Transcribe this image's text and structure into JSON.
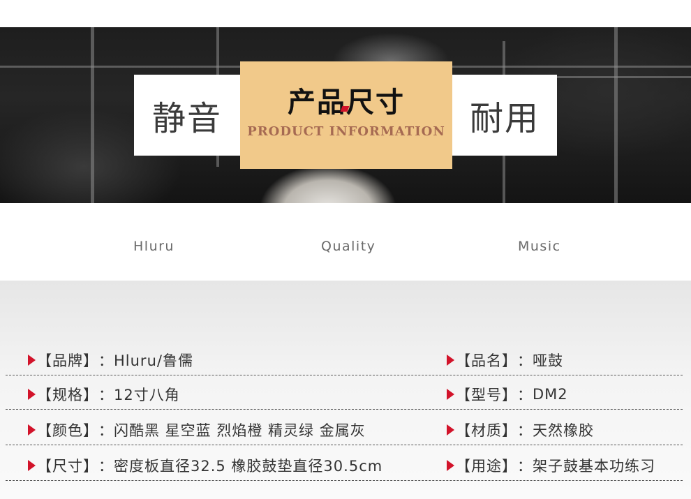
{
  "banner": {
    "left_word": "静音",
    "title_cn": "产品尺寸",
    "title_en": "PRODUCT INFORMATION",
    "right_word": "耐用"
  },
  "taglines": [
    "Hluru",
    "Quality",
    "Music"
  ],
  "specs": {
    "left": [
      {
        "label": "【品牌】",
        "sep": "：",
        "value": "Hluru/鲁儒"
      },
      {
        "label": "【规格】",
        "sep": "：",
        "value": "12寸八角"
      },
      {
        "label": "【颜色】",
        "sep": "：",
        "value": "闪酷黑 星空蓝 烈焰橙 精灵绿 金属灰"
      },
      {
        "label": "【尺寸】",
        "sep": "：",
        "value": "密度板直径32.5 橡胶鼓垫直径30.5cm"
      }
    ],
    "right": [
      {
        "label": "【品名】",
        "sep": "：",
        "value": "哑鼓"
      },
      {
        "label": "【型号】",
        "sep": "：",
        "value": "DM2"
      },
      {
        "label": "【材质】",
        "sep": "：",
        "value": "天然橡胶"
      },
      {
        "label": "【用途】",
        "sep": "：",
        "value": "架子鼓基本功练习"
      }
    ]
  },
  "colors": {
    "accent_red": "#d2132a",
    "title_tile": "#f1c98a",
    "subtitle_brown": "#a66a52"
  },
  "icons": {
    "bullet": "red-triangle-icon"
  }
}
